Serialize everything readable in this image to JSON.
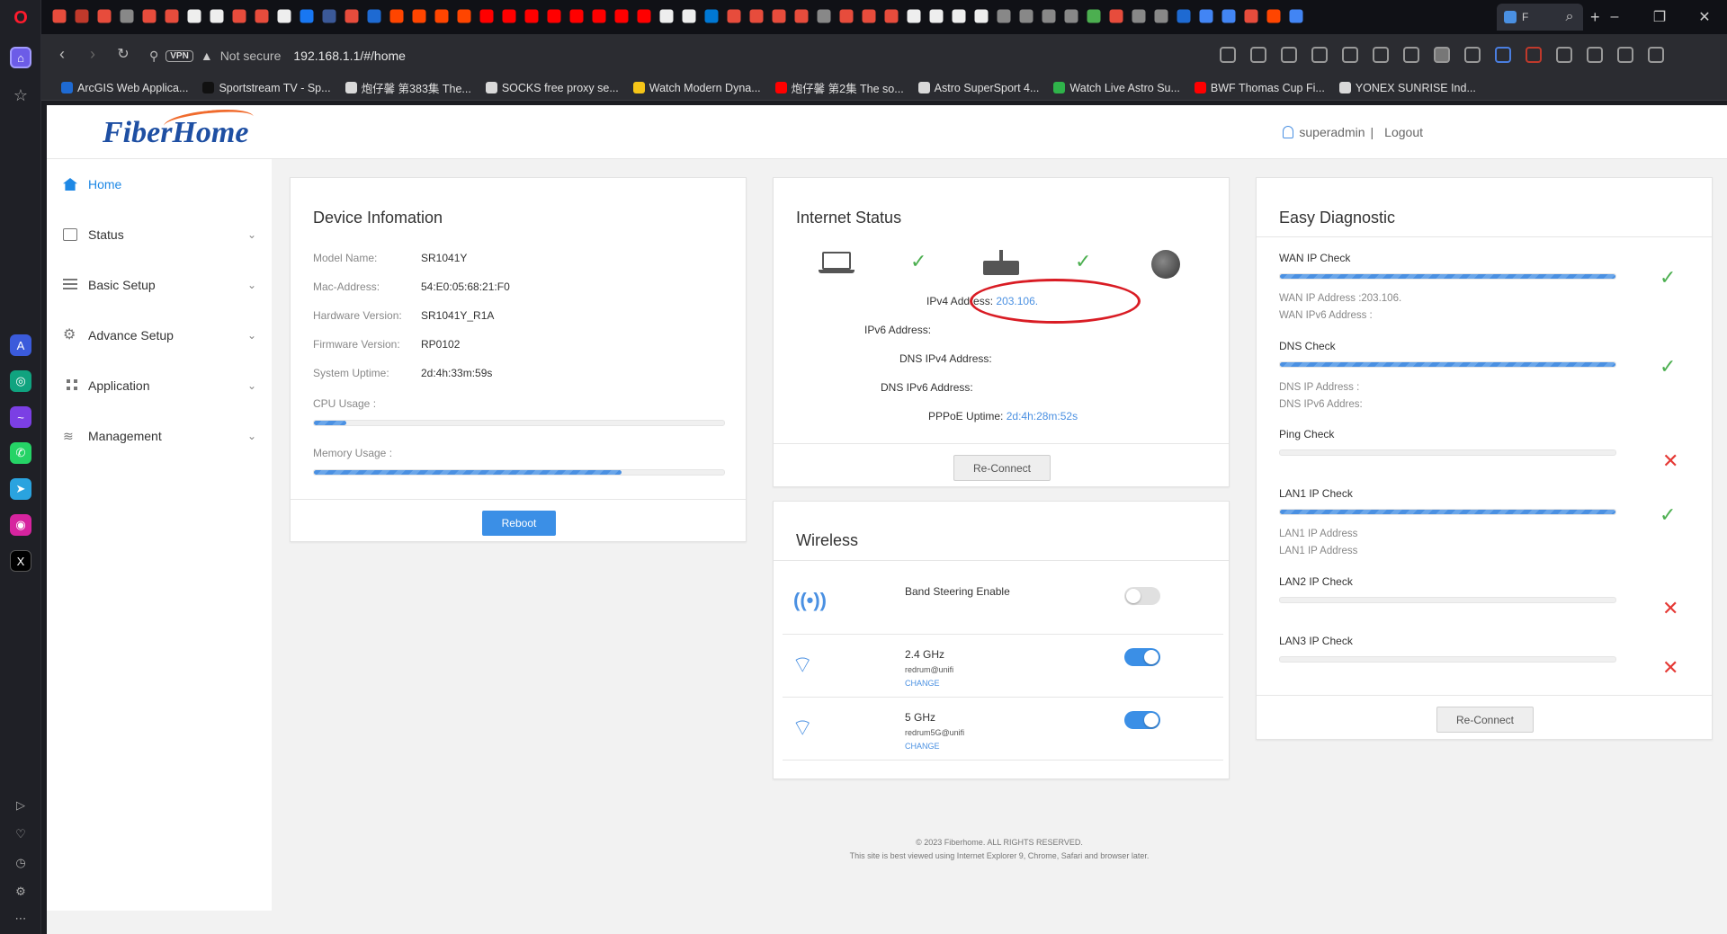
{
  "browser": {
    "url": "192.168.1.1/#/home",
    "security_label": "Not secure",
    "vpn_label": "VPN",
    "active_tab_label": "F",
    "bookmarks": [
      {
        "label": "ArcGIS Web Applica...",
        "color": "#1e6ad2"
      },
      {
        "label": "Sportstream TV - Sp...",
        "color": "#111111"
      },
      {
        "label": "炮仔馨 第383集 The...",
        "color": "#d9d9d9"
      },
      {
        "label": "SOCKS free proxy se...",
        "color": "#d9d9d9"
      },
      {
        "label": "Watch Modern Dyna...",
        "color": "#f5c518"
      },
      {
        "label": "炮仔馨 第2集 The so...",
        "color": "#ff0000"
      },
      {
        "label": "Astro SuperSport 4...",
        "color": "#d9d9d9"
      },
      {
        "label": "Watch Live Astro Su...",
        "color": "#2fb34a"
      },
      {
        "label": "BWF Thomas Cup Fi...",
        "color": "#ff0000"
      },
      {
        "label": "YONEX SUNRISE Ind...",
        "color": "#d9d9d9"
      }
    ]
  },
  "header": {
    "logo": "FiberHome",
    "username": "superadmin",
    "separator": "|",
    "logout": "Logout"
  },
  "nav": [
    {
      "label": "Home",
      "icon": "home-icon",
      "active": true
    },
    {
      "label": "Status",
      "icon": "status-icon"
    },
    {
      "label": "Basic Setup",
      "icon": "list-icon"
    },
    {
      "label": "Advance Setup",
      "icon": "gear-icon"
    },
    {
      "label": "Application",
      "icon": "grid-icon"
    },
    {
      "label": "Management",
      "icon": "layers-icon"
    }
  ],
  "device": {
    "title": "Device Infomation",
    "rows": [
      {
        "label": "Model Name:",
        "value": "SR1041Y"
      },
      {
        "label": "Mac-Address:",
        "value": "54:E0:05:68:21:F0"
      },
      {
        "label": "Hardware Version:",
        "value": "SR1041Y_R1A"
      },
      {
        "label": "Firmware Version:",
        "value": "RP0102"
      },
      {
        "label": "System Uptime:",
        "value": "2d:4h:33m:59s"
      }
    ],
    "cpu_label": "CPU Usage :",
    "cpu_percent": 8,
    "memory_label": "Memory Usage :",
    "memory_percent": 75,
    "reboot": "Reboot"
  },
  "internet": {
    "title": "Internet Status",
    "ipv4_label": "IPv4 Address:",
    "ipv4_value": "203.106.",
    "ipv6_label": "IPv6 Address:",
    "dns4_label": "DNS IPv4 Address:",
    "dns6_label": "DNS IPv6 Address:",
    "pppoe_label": "PPPoE Uptime:",
    "pppoe_value": "2d:4h:28m:52s",
    "reconnect": "Re-Connect"
  },
  "wireless": {
    "title": "Wireless",
    "band_steering": {
      "label": "Band Steering Enable",
      "enabled": false
    },
    "bands": [
      {
        "label": "2.4 GHz",
        "ssid": "redrum@unifi",
        "change": "CHANGE",
        "enabled": true
      },
      {
        "label": "5 GHz",
        "ssid": "redrum5G@unifi",
        "change": "CHANGE",
        "enabled": true
      }
    ]
  },
  "diagnostic": {
    "title": "Easy Diagnostic",
    "wan_title": "WAN IP Check",
    "wan_ipv4": "WAN IP Address :203.106.",
    "wan_ipv6": "WAN IPv6 Address :",
    "dns_title": "DNS Check",
    "dns_ip": "DNS IP Address :",
    "dns_ipv6": "DNS IPv6 Addres:",
    "ping_title": "Ping Check",
    "lan1_title": "LAN1 IP Check",
    "lan1_ip": "LAN1 IP Address",
    "lan1_ip2": "LAN1 IP Address",
    "lan2_title": "LAN2 IP Check",
    "lan3_title": "LAN3 IP Check",
    "reconnect": "Re-Connect"
  },
  "footer": {
    "copyright": "© 2023 Fiberhome. ALL RIGHTS RESERVED.",
    "note": "This site is best viewed using Internet Explorer 9, Chrome, Safari and browser later."
  }
}
